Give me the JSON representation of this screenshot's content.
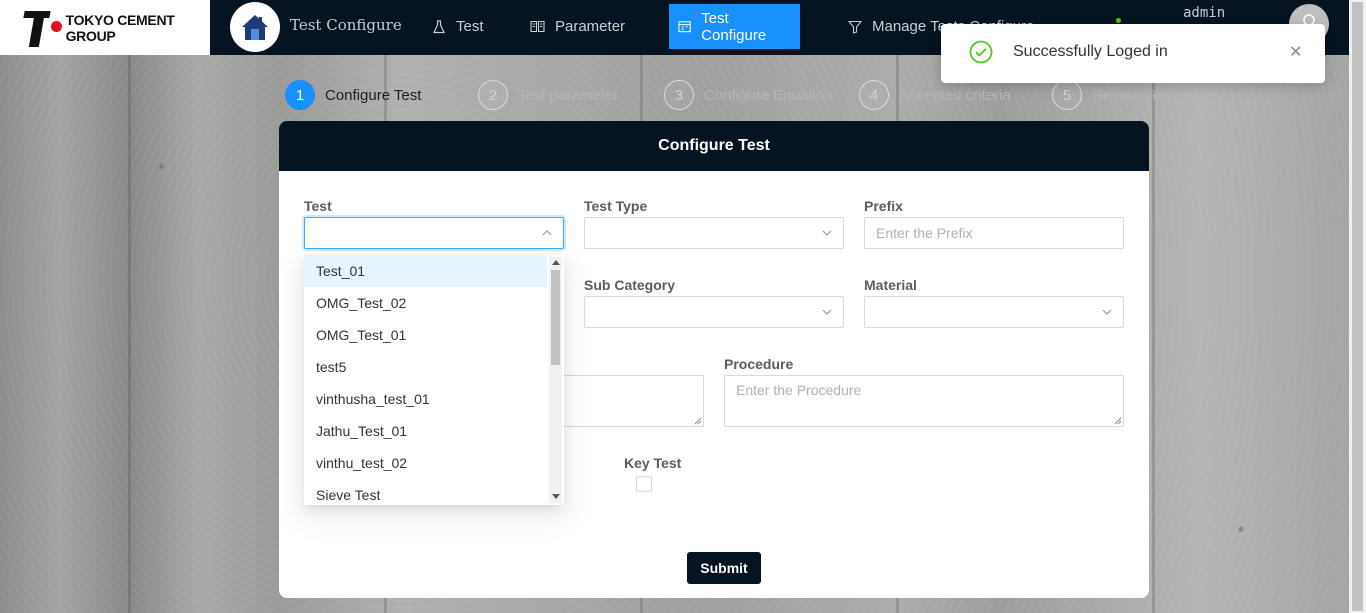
{
  "brand": {
    "logo_text": "TOKYO CEMENT GROUP",
    "app_title": "Test Configure"
  },
  "nav": [
    {
      "label": "Test",
      "icon": "flask-icon",
      "active": false
    },
    {
      "label": "Parameter",
      "icon": "book-icon",
      "active": false
    },
    {
      "label": "Test Configure",
      "icon": "calendar-icon",
      "active": true
    },
    {
      "label": "Manage Tests Configure",
      "icon": "funnel-icon",
      "active": false
    }
  ],
  "user": {
    "name": "admin"
  },
  "toast": {
    "message": "Successfully Loged in"
  },
  "steps": [
    {
      "num": "1",
      "label": "Configure Test",
      "active": true
    },
    {
      "num": "2",
      "label": "Test parameter",
      "active": false
    },
    {
      "num": "3",
      "label": "Configure Equation",
      "active": false
    },
    {
      "num": "4",
      "label": "Accepted criteria",
      "active": false
    },
    {
      "num": "5",
      "label": "Review Test",
      "active": false
    }
  ],
  "form": {
    "title": "Configure Test",
    "test_label": "Test",
    "test_type_label": "Test Type",
    "prefix_label": "Prefix",
    "prefix_placeholder": "Enter the Prefix",
    "sub_category_label": "Sub Category",
    "material_label": "Material",
    "procedure_label": "Procedure",
    "procedure_placeholder": "Enter the Procedure",
    "key_test_label": "Key Test",
    "submit_label": "Submit"
  },
  "test_options": [
    "Test_01",
    "OMG_Test_02",
    "OMG_Test_01",
    "test5",
    "vinthusha_test_01",
    "Jathu_Test_01",
    "vinthu_test_02",
    "Sieve Test"
  ],
  "colors": {
    "nav_bg": "#061321",
    "accent": "#1890ff",
    "success": "#52c41a"
  }
}
